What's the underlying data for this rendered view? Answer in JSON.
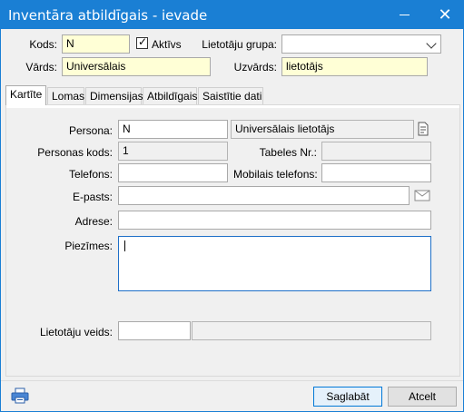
{
  "window": {
    "title": "Inventāra atbildīgais - ievade"
  },
  "header": {
    "kods_label": "Kods:",
    "kods_value": "N",
    "aktivs_label": "Aktīvs",
    "aktivs_checked": true,
    "grupa_label": "Lietotāju grupa:",
    "grupa_value": "",
    "vards_label": "Vārds:",
    "vards_value": "Universālais",
    "uzvards_label": "Uzvārds:",
    "uzvards_value": "lietotājs"
  },
  "tabs": [
    {
      "label": "Kartīte",
      "active": true
    },
    {
      "label": "Lomas"
    },
    {
      "label": "Dimensijas"
    },
    {
      "label": "Atbildīgais"
    },
    {
      "label": "Saistītie dati"
    }
  ],
  "form": {
    "persona_label": "Persona:",
    "persona_code": "N",
    "persona_name": "Universālais lietotājs",
    "personas_kods_label": "Personas kods:",
    "personas_kods_value": "1",
    "tabeles_label": "Tabeles Nr.:",
    "tabeles_value": "",
    "telefons_label": "Telefons:",
    "telefons_value": "",
    "mobilais_label": "Mobilais telefons:",
    "mobilais_value": "",
    "epasts_label": "E-pasts:",
    "epasts_value": "",
    "adrese_label": "Adrese:",
    "adrese_value": "",
    "piezimes_label": "Piezīmes:",
    "piezimes_value": "",
    "veids_label": "Lietotāju veids:",
    "veids_code": "",
    "veids_name": ""
  },
  "footer": {
    "save_label": "Saglabāt",
    "cancel_label": "Atcelt"
  },
  "icons": {
    "minimize": "minimize-icon",
    "close": "close-icon",
    "lookup": "document-lookup-icon",
    "mail": "envelope-icon",
    "print": "printer-icon"
  },
  "colors": {
    "titlebar": "#1a7fd4",
    "required_field": "#ffffd6",
    "focus_border": "#1e6fc8"
  }
}
